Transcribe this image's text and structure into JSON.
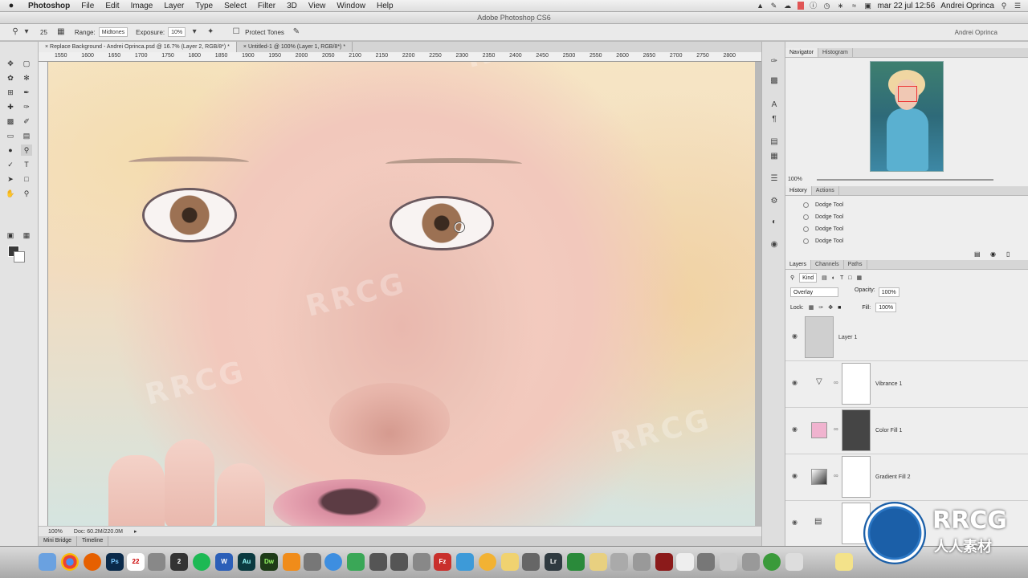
{
  "menubar": {
    "app": "Photoshop",
    "items": [
      "File",
      "Edit",
      "Image",
      "Layer",
      "Type",
      "Select",
      "Filter",
      "3D",
      "View",
      "Window",
      "Help"
    ],
    "datetime": "mar 22 jul  12:56",
    "user": "Andrei Oprinca"
  },
  "window": {
    "title": "Adobe Photoshop CS6"
  },
  "options": {
    "brush_size": "25",
    "range_label": "Range:",
    "range_value": "Midtones",
    "exposure_label": "Exposure:",
    "exposure_value": "10%",
    "protect_tones": "Protect Tones",
    "user": "Andrei Oprinca"
  },
  "doc_tabs": [
    "Replace Background - Andrei Oprinca.psd @ 16.7% (Layer 2, RGB/8*) *",
    "Untitled-1 @ 100% (Layer 1, RGB/8*) *"
  ],
  "ruler": [
    "1550",
    "1600",
    "1650",
    "1700",
    "1750",
    "1800",
    "1850",
    "1900",
    "1950",
    "2000",
    "2050",
    "2100",
    "2150",
    "2200",
    "2250",
    "2300",
    "2350",
    "2400",
    "2450",
    "2500",
    "2550",
    "2600",
    "2650",
    "2700",
    "2750",
    "2800"
  ],
  "status": {
    "zoom": "100%",
    "doc": "Doc: 60.2M/220.0M"
  },
  "bottom_tabs": [
    "Mini Bridge",
    "Timeline"
  ],
  "navigator": {
    "tabs": [
      "Navigator",
      "Histogram"
    ],
    "zoom": "100%"
  },
  "history": {
    "tabs": [
      "History",
      "Actions"
    ],
    "items": [
      "Dodge Tool",
      "Dodge Tool",
      "Dodge Tool",
      "Dodge Tool"
    ]
  },
  "layers": {
    "tabs": [
      "Layers",
      "Channels",
      "Paths"
    ],
    "kind": "Kind",
    "blend_mode": "Overlay",
    "opacity_label": "Opacity:",
    "opacity_value": "100%",
    "lock_label": "Lock:",
    "fill_label": "Fill:",
    "fill_value": "100%",
    "rows": [
      {
        "name": "Layer 1"
      },
      {
        "name": "Vibrance 1"
      },
      {
        "name": "Color Fill 1"
      },
      {
        "name": "Gradient Fill 2"
      },
      {
        "name": ""
      }
    ]
  },
  "watermark": "RRCG",
  "logo": {
    "text": "RRCG",
    "sub": "人人素材"
  },
  "colors": {
    "accent": "#1b5fa8",
    "fill_swatch": "#f0b3cf",
    "foreground": "#3a3a3a"
  }
}
